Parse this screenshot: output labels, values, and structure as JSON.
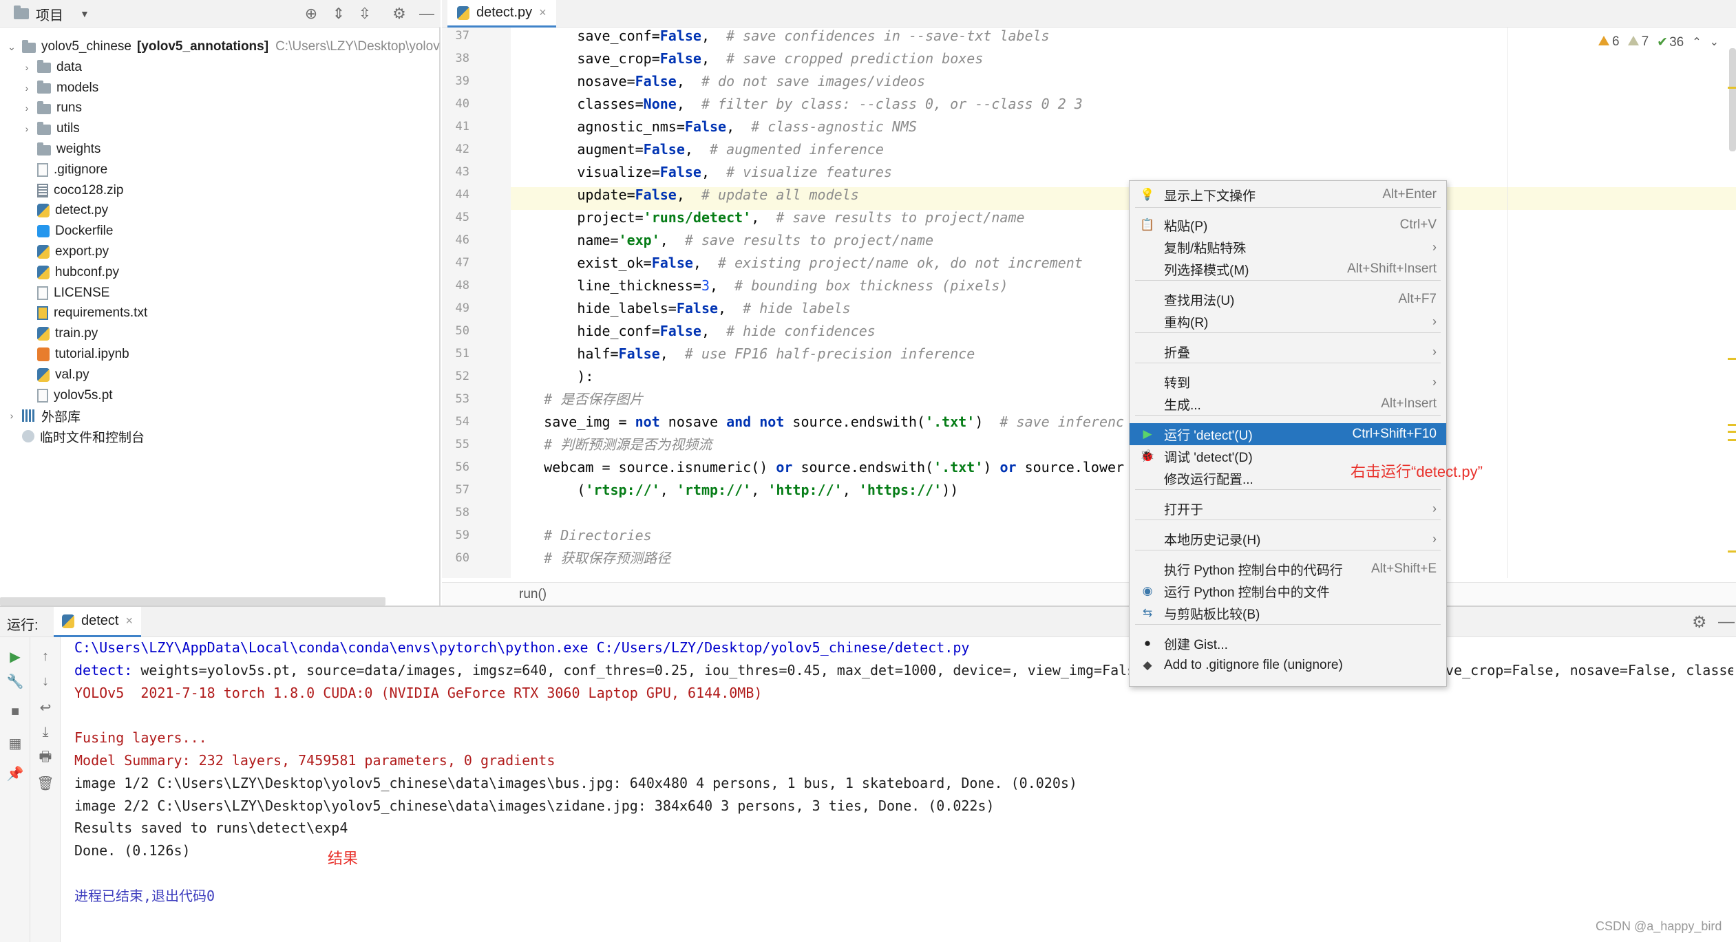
{
  "project_panel": {
    "title": "项目",
    "tree": [
      {
        "label": "yolov5_chinese",
        "bold": "[yolov5_annotations]",
        "path": "C:\\Users\\LZY\\Desktop\\yolov",
        "icon": "folder-icon",
        "arrow": "⌄"
      },
      {
        "label": "data",
        "icon": "folder-icon",
        "arrow": "›"
      },
      {
        "label": "models",
        "icon": "folder-icon",
        "arrow": "›"
      },
      {
        "label": "runs",
        "icon": "folder-icon",
        "arrow": "›"
      },
      {
        "label": "utils",
        "icon": "folder-icon",
        "arrow": "›"
      },
      {
        "label": "weights",
        "icon": "folder-icon"
      },
      {
        "label": ".gitignore",
        "icon": "file-icon"
      },
      {
        "label": "coco128.zip",
        "icon": "zip-icon"
      },
      {
        "label": "detect.py",
        "icon": "python-file-icon"
      },
      {
        "label": "Dockerfile",
        "icon": "docker-icon"
      },
      {
        "label": "export.py",
        "icon": "python-file-icon"
      },
      {
        "label": "hubconf.py",
        "icon": "python-file-icon"
      },
      {
        "label": "LICENSE",
        "icon": "file-icon"
      },
      {
        "label": "requirements.txt",
        "icon": "text-file-icon"
      },
      {
        "label": "train.py",
        "icon": "python-file-icon"
      },
      {
        "label": "tutorial.ipynb",
        "icon": "notebook-icon"
      },
      {
        "label": "val.py",
        "icon": "python-file-icon"
      },
      {
        "label": "yolov5s.pt",
        "icon": "file-icon"
      },
      {
        "label": "外部库",
        "icon": "library-icon",
        "arrow": "›"
      },
      {
        "label": "临时文件和控制台",
        "icon": "scratch-icon"
      }
    ]
  },
  "editor": {
    "tab_label": "detect.py",
    "breadcrumb": "run()",
    "inspections": {
      "warnings": "6",
      "weak_warnings": "7",
      "ok": "36"
    },
    "line_numbers": [
      "37",
      "38",
      "39",
      "40",
      "41",
      "42",
      "43",
      "44",
      "45",
      "46",
      "47",
      "48",
      "49",
      "50",
      "51",
      "52",
      "53",
      "54",
      "55",
      "56",
      "57",
      "58",
      "59",
      "60"
    ],
    "lines": [
      [
        {
          "t": "        save_conf="
        },
        {
          "t": "False",
          "c": "kw"
        },
        {
          "t": ",  "
        },
        {
          "t": "# save confidences in --save-txt labels",
          "c": "cm"
        }
      ],
      [
        {
          "t": "        save_crop="
        },
        {
          "t": "False",
          "c": "kw"
        },
        {
          "t": ",  "
        },
        {
          "t": "# save cropped prediction boxes",
          "c": "cm"
        }
      ],
      [
        {
          "t": "        nosave="
        },
        {
          "t": "False",
          "c": "kw"
        },
        {
          "t": ",  "
        },
        {
          "t": "# do not save images/videos",
          "c": "cm"
        }
      ],
      [
        {
          "t": "        classes="
        },
        {
          "t": "None",
          "c": "kw"
        },
        {
          "t": ",  "
        },
        {
          "t": "# filter by class: --class 0, or --class 0 2 3",
          "c": "cm"
        }
      ],
      [
        {
          "t": "        agnostic_nms="
        },
        {
          "t": "False",
          "c": "kw"
        },
        {
          "t": ",  "
        },
        {
          "t": "# class-agnostic NMS",
          "c": "cm"
        }
      ],
      [
        {
          "t": "        augment="
        },
        {
          "t": "False",
          "c": "kw"
        },
        {
          "t": ",  "
        },
        {
          "t": "# augmented inference",
          "c": "cm"
        }
      ],
      [
        {
          "t": "        visualize="
        },
        {
          "t": "False",
          "c": "kw"
        },
        {
          "t": ",  "
        },
        {
          "t": "# visualize features",
          "c": "cm"
        }
      ],
      [
        {
          "t": "        update="
        },
        {
          "t": "False",
          "c": "kw"
        },
        {
          "t": ",  "
        },
        {
          "t": "# update all models",
          "c": "cm"
        }
      ],
      [
        {
          "t": "        project="
        },
        {
          "t": "'runs/detect'",
          "c": "str"
        },
        {
          "t": ",  "
        },
        {
          "t": "# save results to project/name",
          "c": "cm"
        }
      ],
      [
        {
          "t": "        name="
        },
        {
          "t": "'exp'",
          "c": "str"
        },
        {
          "t": ",  "
        },
        {
          "t": "# save results to project/name",
          "c": "cm"
        }
      ],
      [
        {
          "t": "        exist_ok="
        },
        {
          "t": "False",
          "c": "kw"
        },
        {
          "t": ",  "
        },
        {
          "t": "# existing project/name ok, do not increment",
          "c": "cm"
        }
      ],
      [
        {
          "t": "        line_thickness="
        },
        {
          "t": "3",
          "c": "num"
        },
        {
          "t": ",  "
        },
        {
          "t": "# bounding box thickness (pixels)",
          "c": "cm"
        }
      ],
      [
        {
          "t": "        hide_labels="
        },
        {
          "t": "False",
          "c": "kw"
        },
        {
          "t": ",  "
        },
        {
          "t": "# hide labels",
          "c": "cm"
        }
      ],
      [
        {
          "t": "        hide_conf="
        },
        {
          "t": "False",
          "c": "kw"
        },
        {
          "t": ",  "
        },
        {
          "t": "# hide confidences",
          "c": "cm"
        }
      ],
      [
        {
          "t": "        half="
        },
        {
          "t": "False",
          "c": "kw"
        },
        {
          "t": ",  "
        },
        {
          "t": "# use FP16 half-precision inference",
          "c": "cm"
        }
      ],
      [
        {
          "t": "        ):"
        }
      ],
      [
        {
          "t": "    "
        },
        {
          "t": "# 是否保存图片",
          "c": "cm"
        }
      ],
      [
        {
          "t": "    save_img = "
        },
        {
          "t": "not",
          "c": "kw"
        },
        {
          "t": " nosave "
        },
        {
          "t": "and",
          "c": "kw"
        },
        {
          "t": " "
        },
        {
          "t": "not",
          "c": "kw"
        },
        {
          "t": " source.endswith("
        },
        {
          "t": "'.txt'",
          "c": "str"
        },
        {
          "t": ")  "
        },
        {
          "t": "# save inferenc",
          "c": "cm"
        }
      ],
      [
        {
          "t": "    "
        },
        {
          "t": "# 判断预测源是否为视频流",
          "c": "cm"
        }
      ],
      [
        {
          "t": "    webcam = source.isnumeric() "
        },
        {
          "t": "or",
          "c": "kw"
        },
        {
          "t": " source.endswith("
        },
        {
          "t": "'.txt'",
          "c": "str"
        },
        {
          "t": ") "
        },
        {
          "t": "or",
          "c": "kw"
        },
        {
          "t": " source.lower"
        }
      ],
      [
        {
          "t": "        ("
        },
        {
          "t": "'rtsp://'",
          "c": "str"
        },
        {
          "t": ", "
        },
        {
          "t": "'rtmp://'",
          "c": "str"
        },
        {
          "t": ", "
        },
        {
          "t": "'http://'",
          "c": "str"
        },
        {
          "t": ", "
        },
        {
          "t": "'https://'",
          "c": "str"
        },
        {
          "t": "))"
        }
      ],
      [
        {
          "t": ""
        }
      ],
      [
        {
          "t": "    "
        },
        {
          "t": "# Directories",
          "c": "cm"
        }
      ],
      [
        {
          "t": "    "
        },
        {
          "t": "# 获取保存预测路径",
          "c": "cm"
        }
      ]
    ]
  },
  "context_menu": {
    "items": [
      {
        "label": "显示上下文操作",
        "shortcut": "Alt+Enter",
        "icon": "lightbulb-icon"
      },
      {
        "label": "粘贴(P)",
        "shortcut": "Ctrl+V",
        "icon": "paste-icon"
      },
      {
        "label": "复制/粘贴特殊",
        "arrow": "›"
      },
      {
        "label": "列选择模式(M)",
        "shortcut": "Alt+Shift+Insert"
      },
      {
        "label": "查找用法(U)",
        "shortcut": "Alt+F7"
      },
      {
        "label": "重构(R)",
        "arrow": "›"
      },
      {
        "label": "折叠",
        "arrow": "›"
      },
      {
        "label": "转到",
        "arrow": "›"
      },
      {
        "label": "生成...",
        "shortcut": "Alt+Insert"
      },
      {
        "label": "运行 'detect'(U)",
        "shortcut": "Ctrl+Shift+F10",
        "icon": "run-icon",
        "selected": true
      },
      {
        "label": "调试 'detect'(D)",
        "icon": "debug-icon"
      },
      {
        "label": "修改运行配置..."
      },
      {
        "label": "打开于",
        "arrow": "›"
      },
      {
        "label": "本地历史记录(H)",
        "arrow": "›"
      },
      {
        "label": "执行 Python 控制台中的代码行",
        "shortcut": "Alt+Shift+E"
      },
      {
        "label": "运行 Python 控制台中的文件",
        "icon": "python-console-icon"
      },
      {
        "label": "与剪贴板比较(B)",
        "icon": "compare-icon"
      },
      {
        "label": "创建 Gist...",
        "icon": "github-icon"
      },
      {
        "label": "Add to .gitignore file (unignore)",
        "icon": "gitignore-icon"
      }
    ]
  },
  "run_panel": {
    "label": "运行:",
    "tab_label": "detect",
    "console": [
      {
        "text": "C:\\Users\\LZY\\AppData\\Local\\conda\\conda\\envs\\pytorch\\python.exe C:/Users/LZY/Desktop/yolov5_chinese/detect.py",
        "style": "path"
      },
      {
        "prefix": "detect: ",
        "text": "weights=yolov5s.pt, source=data/images, imgsz=640, conf_thres=0.25, iou_thres=0.45, max_det=1000, device=, view_img=Fals",
        "tail": "ve_crop=False, nosave=False, classe",
        "style": "black"
      },
      {
        "text": "YOLOv5  2021-7-18 torch 1.8.0 CUDA:0 (NVIDIA GeForce RTX 3060 Laptop GPU, 6144.0MB)",
        "style": "red"
      },
      {
        "text": "",
        "style": "black"
      },
      {
        "text": "Fusing layers...",
        "style": "red"
      },
      {
        "text": "Model Summary: 232 layers, 7459581 parameters, 0 gradients",
        "style": "red"
      },
      {
        "text": "image 1/2 C:\\Users\\LZY\\Desktop\\yolov5_chinese\\data\\images\\bus.jpg: 640x480 4 persons, 1 bus, 1 skateboard, Done. (0.020s)",
        "style": "black"
      },
      {
        "text": "image 2/2 C:\\Users\\LZY\\Desktop\\yolov5_chinese\\data\\images\\zidane.jpg: 384x640 3 persons, 3 ties, Done. (0.022s)",
        "style": "black"
      },
      {
        "text": "Results saved to runs\\detect\\exp4",
        "style": "black"
      },
      {
        "text": "Done. (0.126s)",
        "style": "black"
      },
      {
        "text": "",
        "style": "black"
      },
      {
        "text": "进程已结束,退出代码0",
        "style": "purple"
      }
    ]
  },
  "annotations": {
    "run_hint": "右击运行“detect.py”",
    "result_hint": "结果"
  },
  "watermark": "CSDN @a_happy_bird"
}
